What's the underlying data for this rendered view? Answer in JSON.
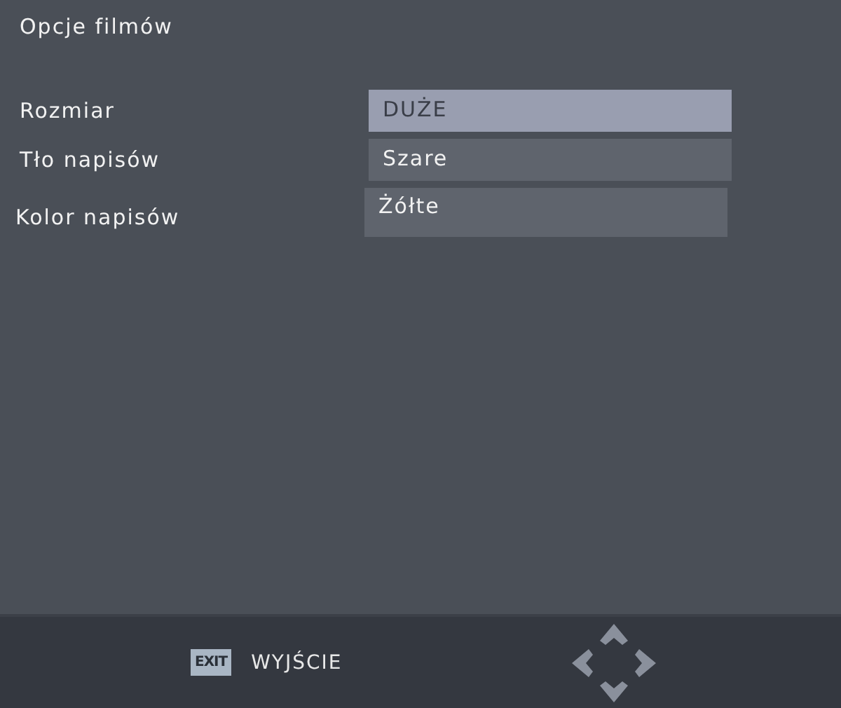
{
  "title": "Opcje filmów",
  "options": [
    {
      "label": "Rozmiar",
      "value": "DUŻE",
      "selected": true
    },
    {
      "label": "Tło napisów",
      "value": "Szare",
      "selected": false
    },
    {
      "label": "Kolor napisów",
      "value": "Żółte",
      "selected": false
    }
  ],
  "footer": {
    "key": "EXIT",
    "action": "WYJŚCIE"
  }
}
